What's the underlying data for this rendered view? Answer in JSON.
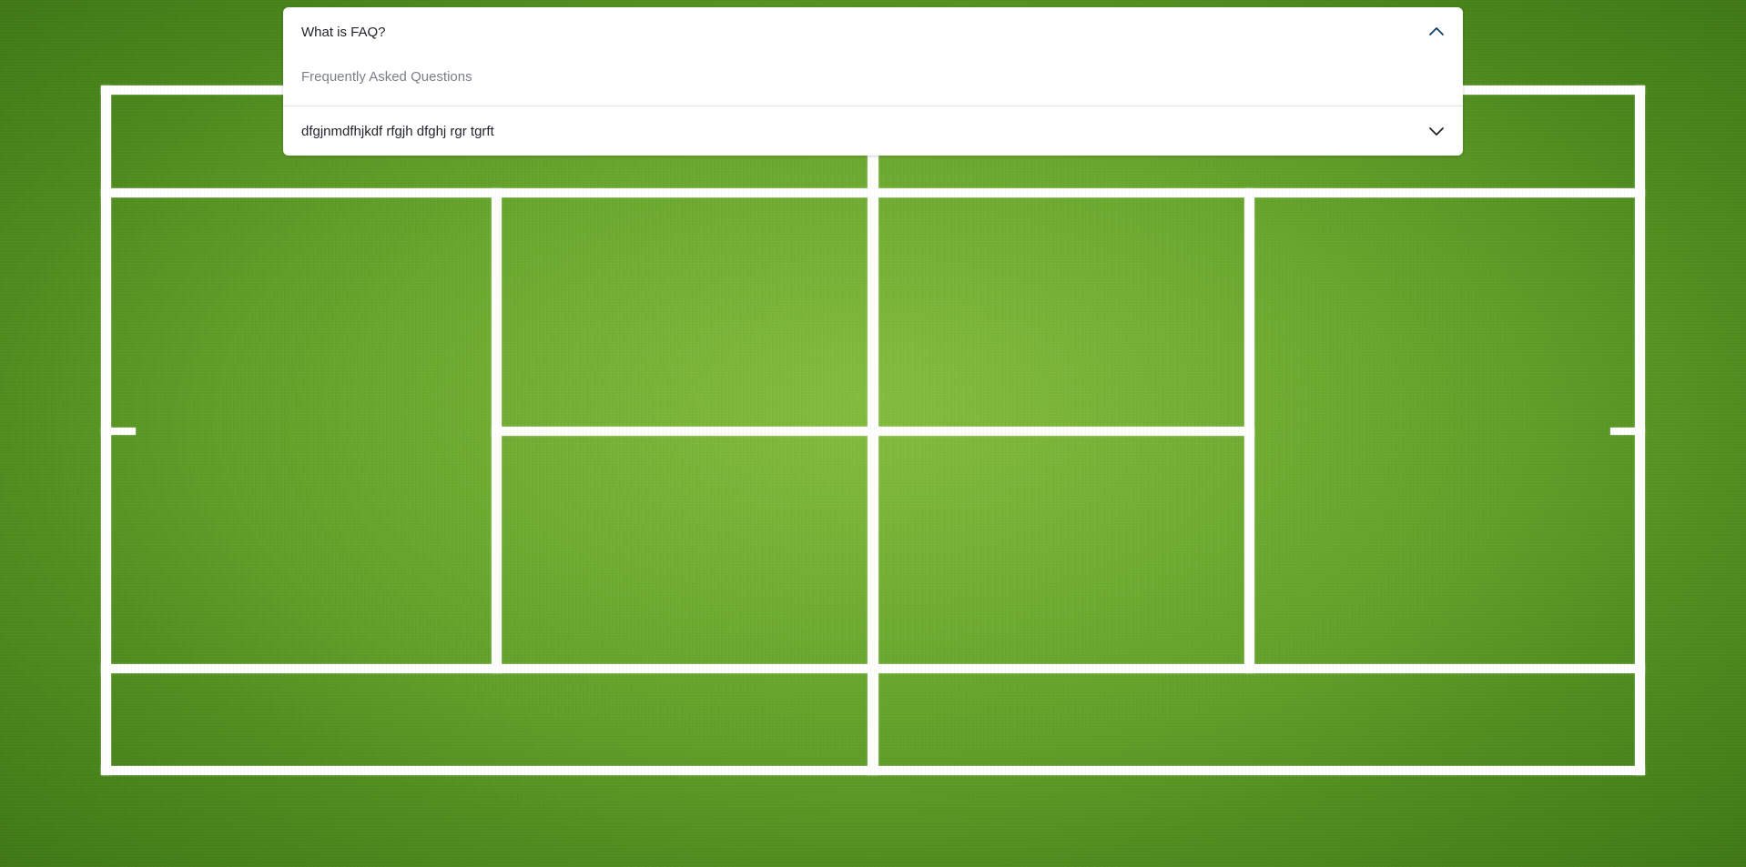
{
  "faq": {
    "items": [
      {
        "question": "What is FAQ?",
        "answer": "Frequently Asked Questions",
        "expanded": true,
        "icon": "chevron-up-icon"
      },
      {
        "question": "dfgjnmdfhjkdf rfgjh dfghj rgr tgrft",
        "expanded": false,
        "icon": "chevron-down-icon"
      }
    ]
  },
  "colors": {
    "grass": "#5f9f29",
    "court_lines": "#ffffff",
    "accent_chevron_active": "#0c3e6b"
  }
}
